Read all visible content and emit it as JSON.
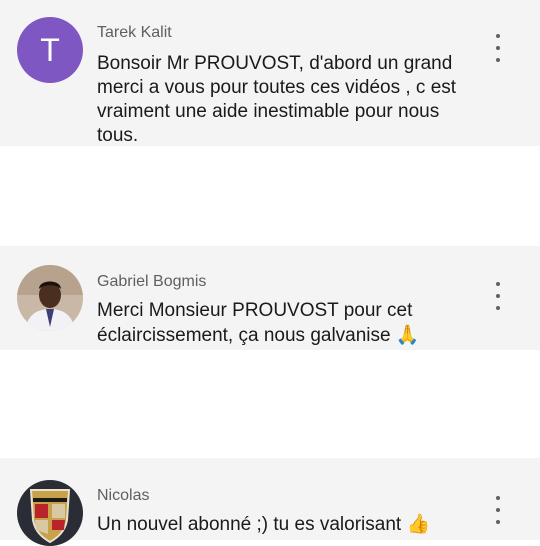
{
  "comments": [
    {
      "avatar_letter": "T",
      "author": "Tarek Kalit",
      "text": "Bonsoir Mr PROUVOST, d'abord un grand merci a vous pour toutes ces vidéos ,  c est vraiment une aide inestimable pour nous tous."
    },
    {
      "avatar_icon": "profile-photo",
      "author": "Gabriel Bogmis",
      "text": "Merci Monsieur PROUVOST pour cet éclaircissement, ça nous galvanise",
      "emoji": "🙏"
    },
    {
      "avatar_icon": "porsche-crest-photo",
      "author": "Nicolas",
      "text": "Un nouvel abonné ;) tu es valorisant",
      "emoji": "👍"
    }
  ]
}
